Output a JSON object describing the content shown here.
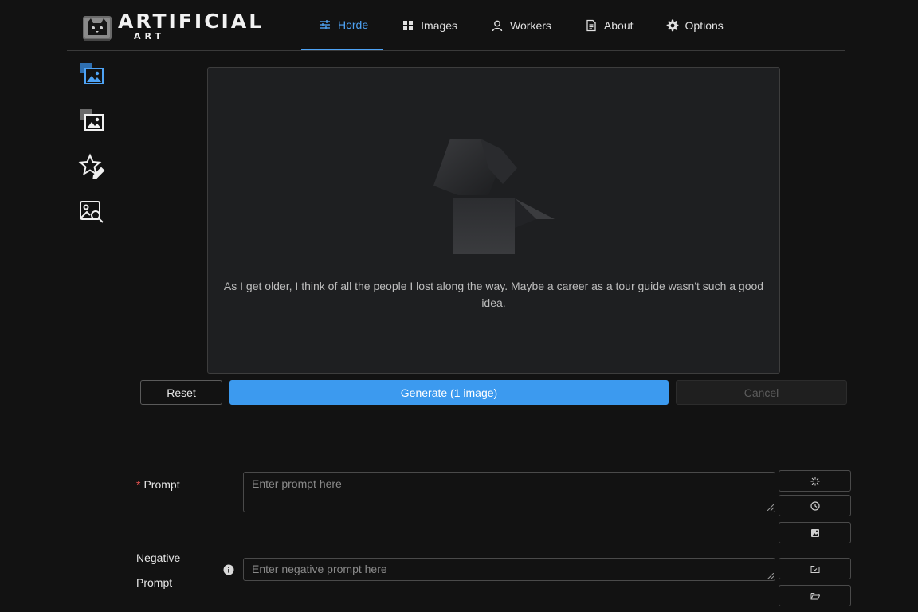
{
  "logo": {
    "title": "ARTIFICIAL",
    "subtitle": "ART"
  },
  "nav": [
    {
      "label": "Horde",
      "icon": "sliders-icon",
      "active": true
    },
    {
      "label": "Images",
      "icon": "grid-icon",
      "active": false
    },
    {
      "label": "Workers",
      "icon": "user-icon",
      "active": false
    },
    {
      "label": "About",
      "icon": "document-icon",
      "active": false
    },
    {
      "label": "Options",
      "icon": "gear-icon",
      "active": false
    }
  ],
  "sidebar": [
    {
      "icon": "generate-images-icon",
      "active": true
    },
    {
      "icon": "image-to-image-icon",
      "active": false
    },
    {
      "icon": "star-edit-icon",
      "active": false
    },
    {
      "icon": "image-search-icon",
      "active": false
    }
  ],
  "preview": {
    "message": "As I get older, I think of all the people I lost along the way. Maybe a career as a tour guide wasn't such a good idea."
  },
  "actions": {
    "reset_label": "Reset",
    "generate_label": "Generate (1 image)",
    "cancel_label": "Cancel"
  },
  "form": {
    "prompt_required_marker": "*",
    "prompt_label": "Prompt",
    "prompt_placeholder": "Enter prompt here",
    "prompt_value": "",
    "negative_label_line1": "Negative",
    "negative_label_line2": "Prompt",
    "negative_placeholder": "Enter negative prompt here",
    "negative_value": ""
  },
  "tool_buttons": [
    "sparkle-icon",
    "history-icon",
    "image-icon",
    "save-folder-icon",
    "open-folder-icon"
  ],
  "colors": {
    "accent": "#3c9aef",
    "background": "#121212",
    "panel": "#1e1f21",
    "required": "#e0504e"
  }
}
